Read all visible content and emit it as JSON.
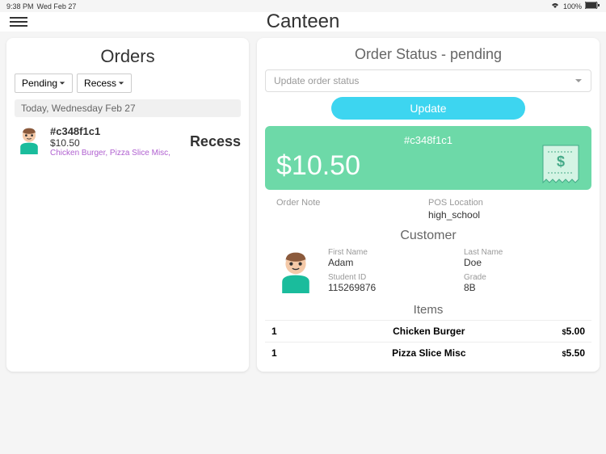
{
  "statusBar": {
    "time": "9:38 PM",
    "date": "Wed Feb 27",
    "battery": "100%"
  },
  "appTitle": "Canteen",
  "ordersPanel": {
    "title": "Orders",
    "filter1": "Pending",
    "filter2": "Recess",
    "dateHeader": "Today, Wednesday Feb 27",
    "order": {
      "id": "#c348f1c1",
      "price": "$10.50",
      "items": "Chicken Burger, Pizza Slice Misc,",
      "tag": "Recess"
    }
  },
  "statusPanel": {
    "title": "Order Status - pending",
    "selectPlaceholder": "Update order status",
    "updateBtn": "Update",
    "orderCard": {
      "id": "#c348f1c1",
      "price": "$10.50"
    },
    "orderNoteLabel": "Order Note",
    "posLabel": "POS Location",
    "posValue": "high_school",
    "customerTitle": "Customer",
    "customer": {
      "firstNameLabel": "First Name",
      "firstName": "Adam",
      "lastNameLabel": "Last Name",
      "lastName": "Doe",
      "studentIdLabel": "Student ID",
      "studentId": "115269876",
      "gradeLabel": "Grade",
      "grade": "8B"
    },
    "itemsTitle": "Items",
    "items": [
      {
        "qty": "1",
        "name": "Chicken Burger",
        "price": "5.00"
      },
      {
        "qty": "1",
        "name": "Pizza Slice Misc",
        "price": "5.50"
      }
    ]
  }
}
